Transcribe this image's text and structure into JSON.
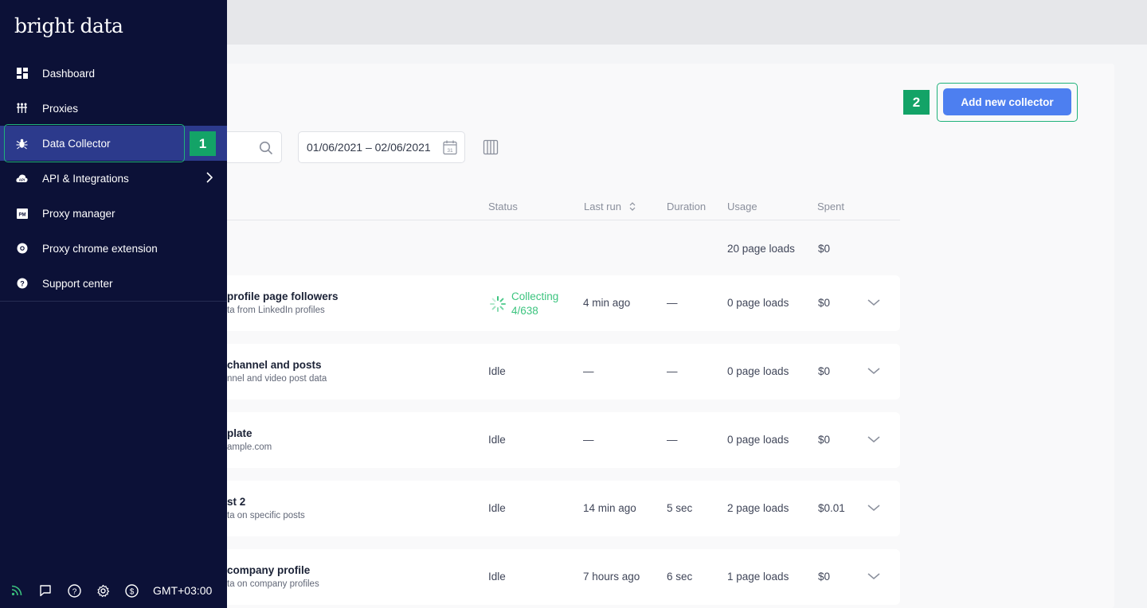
{
  "brand": "bright data",
  "sidebar": {
    "items": [
      {
        "label": "Dashboard",
        "icon": "dashboard-icon"
      },
      {
        "label": "Proxies",
        "icon": "proxies-icon"
      },
      {
        "label": "Data Collector",
        "icon": "bug-icon",
        "active": true
      },
      {
        "label": "API & Integrations",
        "icon": "api-icon",
        "has_children": true
      },
      {
        "label": "Proxy manager",
        "icon": "pm-icon"
      },
      {
        "label": "Proxy chrome extension",
        "icon": "chrome-icon"
      },
      {
        "label": "Support center",
        "icon": "help-circle-icon"
      }
    ],
    "footer": {
      "icons": [
        "rss-icon",
        "chat-icon",
        "help-icon",
        "gear-icon",
        "dollar-icon"
      ],
      "timezone": "GMT+03:00"
    }
  },
  "callouts": {
    "one": "1",
    "two": "2"
  },
  "toolbar": {
    "add_button": "Add new collector",
    "date_range": "01/06/2021 – 02/06/2021",
    "calendar_day": "31"
  },
  "table": {
    "headers": {
      "status": "Status",
      "last_run": "Last run",
      "duration": "Duration",
      "usage": "Usage",
      "spent": "Spent"
    },
    "totals": {
      "usage": "20 page loads",
      "spent": "$0"
    },
    "rows": [
      {
        "name": "profile page followers",
        "desc": "ta from LinkedIn profiles",
        "status": "Collecting",
        "progress": "4/638",
        "last_run": "4 min ago",
        "duration": "—",
        "usage": "0 page loads",
        "spent": "$0"
      },
      {
        "name": "channel and posts",
        "desc": "nnel and video post data",
        "status": "Idle",
        "last_run": "—",
        "duration": "—",
        "usage": "0 page loads",
        "spent": "$0"
      },
      {
        "name": "plate",
        "desc": "ample.com",
        "status": "Idle",
        "last_run": "—",
        "duration": "—",
        "usage": "0 page loads",
        "spent": "$0"
      },
      {
        "name": "st 2",
        "desc": "ta on specific posts",
        "status": "Idle",
        "last_run": "14 min ago",
        "duration": "5 sec",
        "usage": "2 page loads",
        "spent": "$0.01"
      },
      {
        "name": "company profile",
        "desc": "ta on company profiles",
        "status": "Idle",
        "last_run": "7 hours ago",
        "duration": "6 sec",
        "usage": "1 page loads",
        "spent": "$0"
      }
    ]
  },
  "colors": {
    "sidebar_bg": "#0c1137",
    "active_item": "#2c3a8c",
    "accent_button": "#4d7ff0",
    "callout_green": "#13a367",
    "collecting_green": "#3cc47f"
  }
}
